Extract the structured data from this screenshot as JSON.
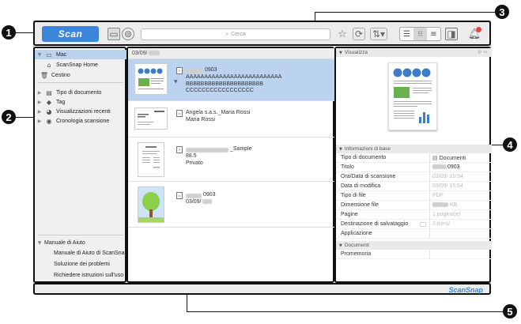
{
  "callouts": [
    "1",
    "2",
    "3",
    "4",
    "5"
  ],
  "toolbar": {
    "scan_label": "Scan",
    "search_placeholder": "Cerca"
  },
  "sidebar": {
    "items": [
      {
        "label": "Mac",
        "icon": "monitor-icon"
      },
      {
        "label": "ScanSnap Home",
        "icon": "home-icon"
      },
      {
        "label": "Cestino",
        "icon": "trash-icon"
      },
      {
        "label": "Tipo di documento",
        "icon": "document-type-icon"
      },
      {
        "label": "Tag",
        "icon": "tag-icon"
      },
      {
        "label": "Visualizzazioni recenti",
        "icon": "recent-icon"
      },
      {
        "label": "Cronologia scansione",
        "icon": "history-icon"
      }
    ],
    "help": {
      "title": "Manuale di Aiuto",
      "items": [
        "Manuale di Aiuto di ScanSnap",
        "Soluzione dei problemi",
        "Richiedere istruzioni sull'uso"
      ]
    }
  },
  "list": {
    "date_header": "03/09/",
    "docs": [
      {
        "line1": "0903",
        "line2": "AAAAAAAAAAAAAAAAAAAAAAAAAA",
        "line3": "BBBBBBBBBBBBBBBBBBBBB",
        "line4": "CCCCCCCCCCCCCCCCC"
      },
      {
        "line1": "Angela s.a.s._Maria Rossi",
        "line2": "Maria Rossi"
      },
      {
        "line1": "_Sample",
        "line2": "88.5",
        "line3": "Privato"
      },
      {
        "line1": "0903",
        "line2": "03/09/"
      }
    ]
  },
  "details": {
    "preview_header": "Visualizza",
    "basic_header": "Informazioni di base",
    "rows": [
      {
        "k": "Tipo di documento",
        "v": "Documenti"
      },
      {
        "k": "Titolo",
        "v": "0903"
      },
      {
        "k": "Ora/Data di scansione",
        "v": "03/09/   15:54"
      },
      {
        "k": "Data di modifica",
        "v": "03/09/   15:54"
      },
      {
        "k": "Tipo di file",
        "v": "PDF"
      },
      {
        "k": "Dimensione file",
        "v": "KB"
      },
      {
        "k": "Pagine",
        "v": "1 pagina(e)"
      },
      {
        "k": "Destinazione di salvataggio",
        "v": "/Users/"
      },
      {
        "k": "Applicazione",
        "v": ""
      }
    ],
    "documents_header": "Documenti",
    "memo_label": "Promemoria"
  },
  "status": {
    "brand": "ScanSnap"
  },
  "colors": {
    "accent": "#3b86d9",
    "selection": "#bcd3f0",
    "badge": "#e8453c"
  }
}
